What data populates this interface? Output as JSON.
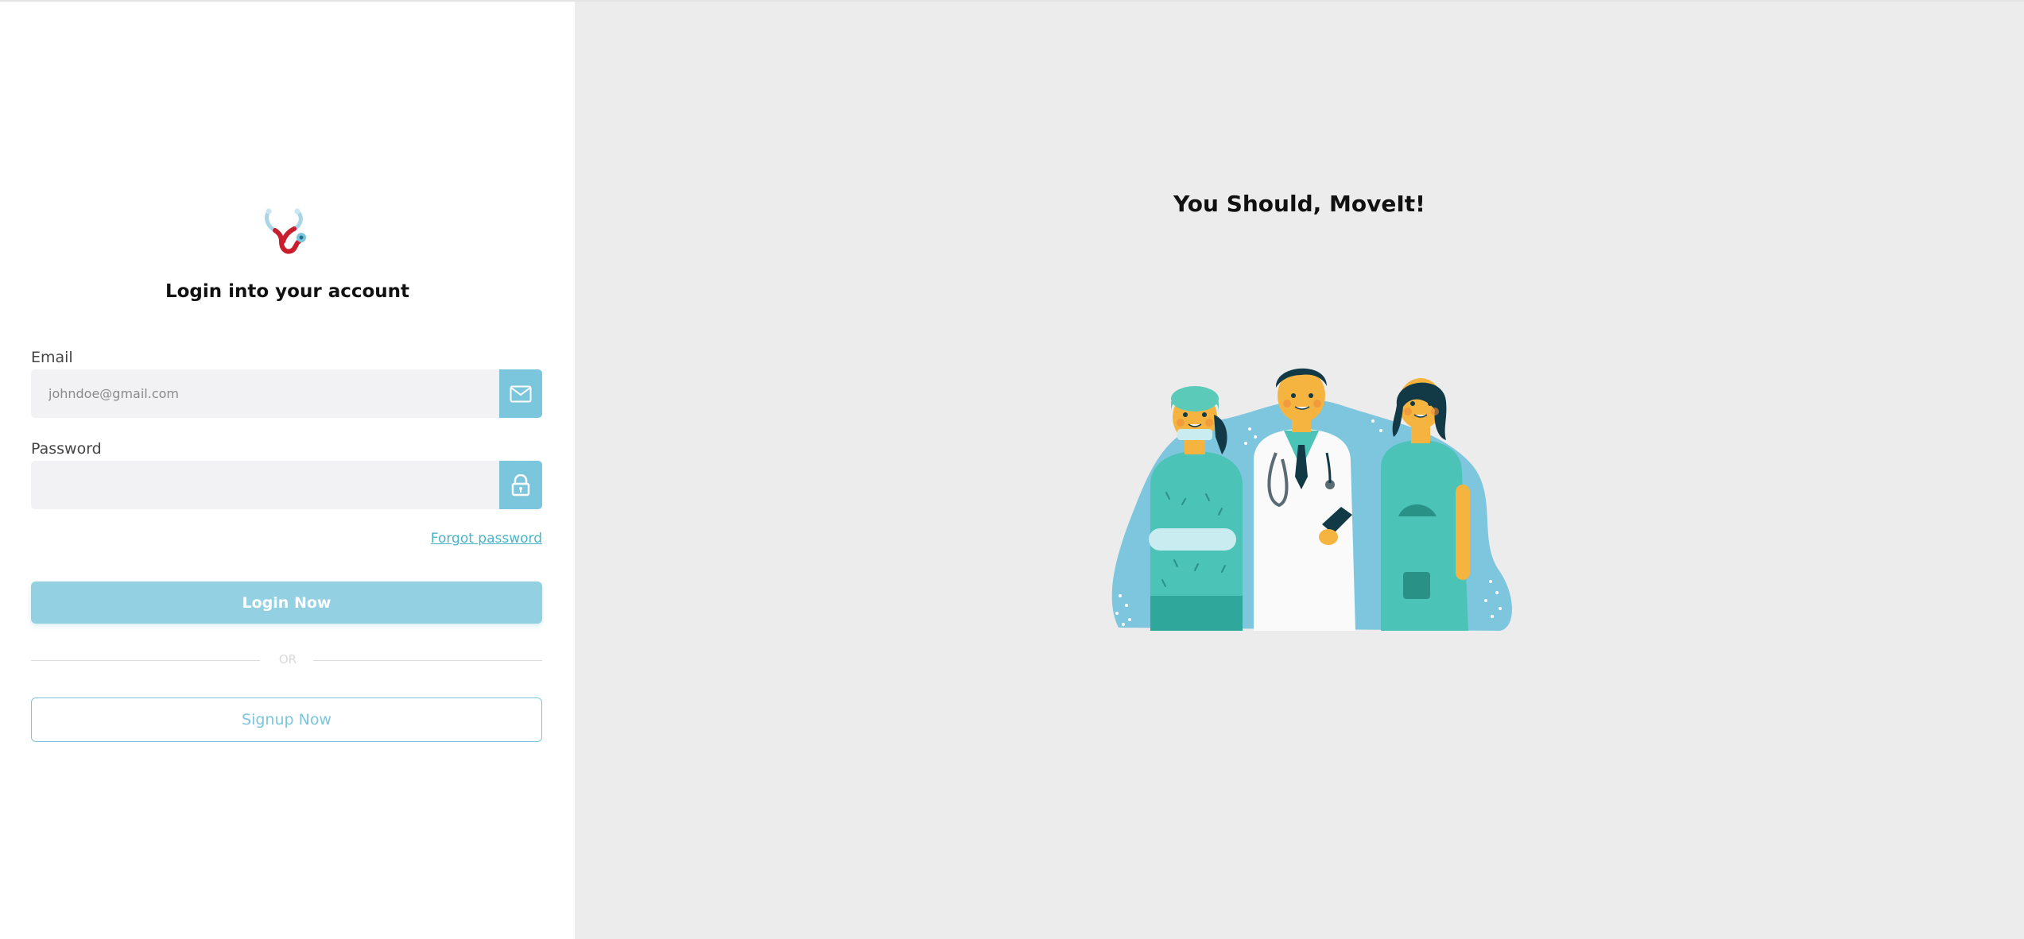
{
  "login": {
    "heading": "Login into your account",
    "email": {
      "label": "Email",
      "placeholder": "johndoe@gmail.com",
      "value": "",
      "icon": "envelope-icon"
    },
    "password": {
      "label": "Password",
      "placeholder": "",
      "value": "",
      "icon": "lock-icon"
    },
    "forgot_password": "Forgot password",
    "login_button": "Login Now",
    "or_text": "OR",
    "signup_button": "Signup Now"
  },
  "hero": {
    "tagline": "You Should, MoveIt!",
    "illustration": "medical-team-illustration"
  },
  "colors": {
    "accent": "#7cc6dd",
    "button_fill": "#93d0e2",
    "link": "#49b5c8",
    "logo_red": "#c81e2d",
    "input_bg": "#f2f2f4",
    "right_panel_bg": "#ececec"
  }
}
